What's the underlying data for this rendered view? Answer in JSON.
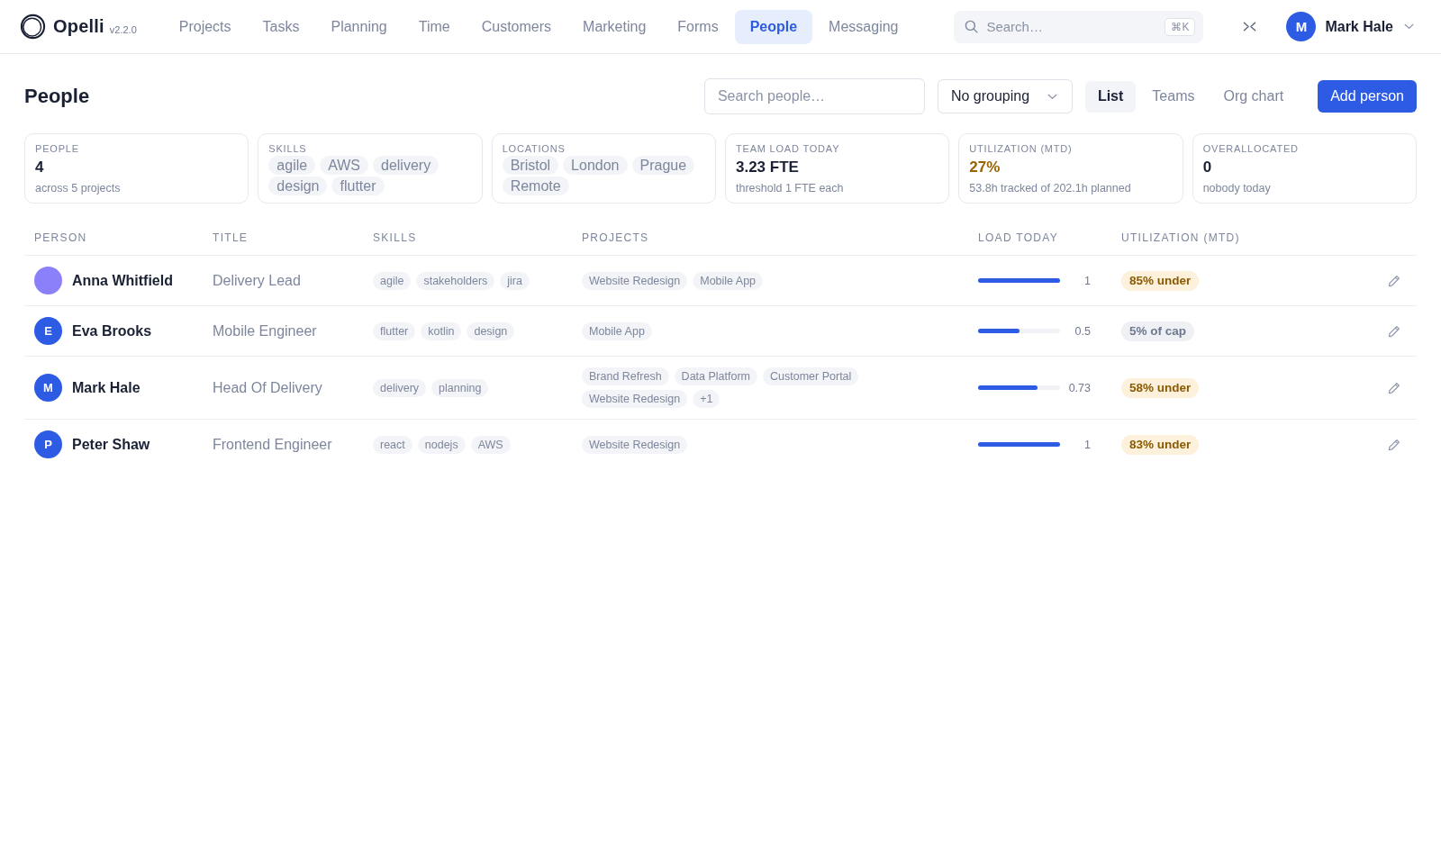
{
  "app": {
    "name": "Opelli",
    "version": "v2.2.0"
  },
  "nav": [
    {
      "label": "Projects",
      "selected": false
    },
    {
      "label": "Tasks",
      "selected": false
    },
    {
      "label": "Planning",
      "selected": false
    },
    {
      "label": "Time",
      "selected": false
    },
    {
      "label": "Customers",
      "selected": false
    },
    {
      "label": "Marketing",
      "selected": false
    },
    {
      "label": "Forms",
      "selected": false
    },
    {
      "label": "People",
      "selected": true
    },
    {
      "label": "Messaging",
      "selected": false
    }
  ],
  "search": {
    "placeholder": "Search…",
    "shortcut": "⌘K"
  },
  "user": {
    "initial": "M",
    "name": "Mark Hale",
    "color": "#2d5be3"
  },
  "page": {
    "title": "People",
    "search": {
      "placeholder": "Search people…"
    },
    "grouping": {
      "value": "No grouping"
    },
    "views": [
      {
        "label": "List",
        "selected": true
      },
      {
        "label": "Teams",
        "selected": false
      },
      {
        "label": "Org chart",
        "selected": false
      }
    ],
    "primary_action": "Add person"
  },
  "summary": [
    {
      "kind": "stat",
      "label": "PEOPLE",
      "value": "4",
      "note": "across 5 projects",
      "warning": false
    },
    {
      "kind": "tags",
      "label": "SKILLS",
      "tags": [
        "agile",
        "AWS",
        "delivery",
        "design",
        "flutter"
      ]
    },
    {
      "kind": "tags",
      "label": "LOCATIONS",
      "tags": [
        "Bristol",
        "London",
        "Prague",
        "Remote"
      ]
    },
    {
      "kind": "stat",
      "label": "TEAM LOAD TODAY",
      "value": "3.23 FTE",
      "note": "threshold 1 FTE each",
      "warning": false
    },
    {
      "kind": "stat",
      "label": "UTILIZATION (MTD)",
      "value": "27%",
      "note": "53.8h tracked of 202.1h planned",
      "warning": true
    },
    {
      "kind": "stat",
      "label": "OVERALLOCATED",
      "value": "0",
      "note": "nobody today",
      "warning": false
    }
  ],
  "table": {
    "columns": [
      "PERSON",
      "TITLE",
      "SKILLS",
      "PROJECTS",
      "LOAD TODAY",
      "UTILIZATION (MTD)"
    ],
    "rows": [
      {
        "name": "Anna Whitfield",
        "avatar": {
          "color": "#8a80f9"
        },
        "title": "Delivery Lead",
        "skills": [
          "agile",
          "stakeholders",
          "jira"
        ],
        "projects": [
          "Website Redesign",
          "Mobile App"
        ],
        "load": {
          "level": 1,
          "reading": "1"
        },
        "utilization": {
          "text": "85% under",
          "warning": true
        }
      },
      {
        "name": "Eva Brooks",
        "avatar": {
          "initial": "E",
          "color": "#2d5be3"
        },
        "title": "Mobile Engineer",
        "skills": [
          "flutter",
          "kotlin",
          "design"
        ],
        "projects": [
          "Mobile App"
        ],
        "load": {
          "level": 0.5,
          "reading": "0.5"
        },
        "utilization": {
          "text": "5% of cap",
          "warning": false
        }
      },
      {
        "name": "Mark Hale",
        "avatar": {
          "initial": "M",
          "color": "#2d5be3"
        },
        "title": "Head Of Delivery",
        "skills": [
          "delivery",
          "planning"
        ],
        "projects": [
          "Brand Refresh",
          "Data Platform",
          "Customer Portal",
          "Website Redesign"
        ],
        "more": "+1",
        "load": {
          "level": 0.73,
          "reading": "0.73"
        },
        "utilization": {
          "text": "58% under",
          "warning": true
        }
      },
      {
        "name": "Peter Shaw",
        "avatar": {
          "initial": "P",
          "color": "#2d5be3"
        },
        "title": "Frontend Engineer",
        "skills": [
          "react",
          "nodejs",
          "AWS"
        ],
        "projects": [
          "Website Redesign"
        ],
        "load": {
          "level": 1,
          "reading": "1"
        },
        "utilization": {
          "text": "83% under",
          "warning": true
        }
      }
    ]
  }
}
